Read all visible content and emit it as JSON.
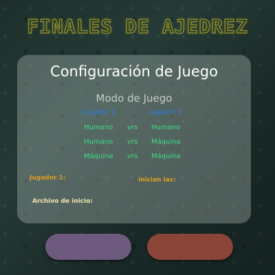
{
  "app": {
    "banner_title": "FINALES DE AJEDREZ"
  },
  "panel": {
    "title": "Configuración de Juego",
    "mode_title": "Modo de Juego",
    "headers": {
      "player1": "Jugador 1",
      "player2": "Jugador 2"
    },
    "modes": [
      {
        "p1": "Humano",
        "vs": "vrs",
        "p2": "Humano"
      },
      {
        "p1": "Humano",
        "vs": "vrs",
        "p2": "Máquina"
      },
      {
        "p1": "Máquina",
        "vs": "vrs",
        "p2": "Máquina"
      }
    ],
    "player1_label": "Jugador 1:",
    "start_label": "inician las:",
    "file_label": "Archivo de inicio:"
  },
  "buttons": {
    "left_label": "",
    "right_label": ""
  },
  "colors": {
    "header_blue": "#2b7de0",
    "option_green": "#3ce082",
    "label_orange": "#e0a020",
    "label_cream": "#f2e6b0",
    "left_button": "#6e5a7e",
    "right_button": "#8a4538"
  }
}
